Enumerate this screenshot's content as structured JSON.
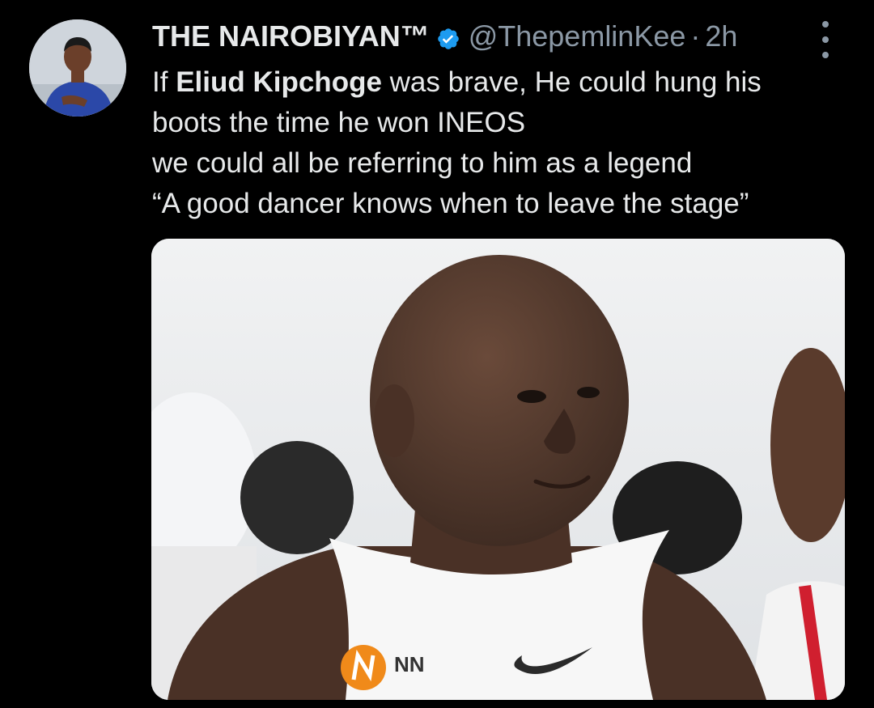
{
  "tweet": {
    "author": {
      "display_name": "THE NAIROBIYAN™",
      "handle": "@ThepemlinKee",
      "separator": "·",
      "time": "2h",
      "verified_icon": "verified-badge-icon",
      "verified_color": "#1d9bf0"
    },
    "text": {
      "line1_prefix": "If ",
      "line1_bold": "Eliud Kipchoge",
      "line1_suffix": " was brave, He could hung his",
      "line2": "boots the time he won INEOS",
      "line3": "we could all be referring to him as a legend",
      "line4": "“A good dancer knows when to leave the stage”"
    },
    "media": {
      "sponsor_logo_text": "NN"
    },
    "more_icon": "more-vertical-icon"
  },
  "colors": {
    "background": "#000000",
    "text_primary": "#e7e9ea",
    "text_secondary": "#8b98a5",
    "accent": "#1d9bf0"
  }
}
